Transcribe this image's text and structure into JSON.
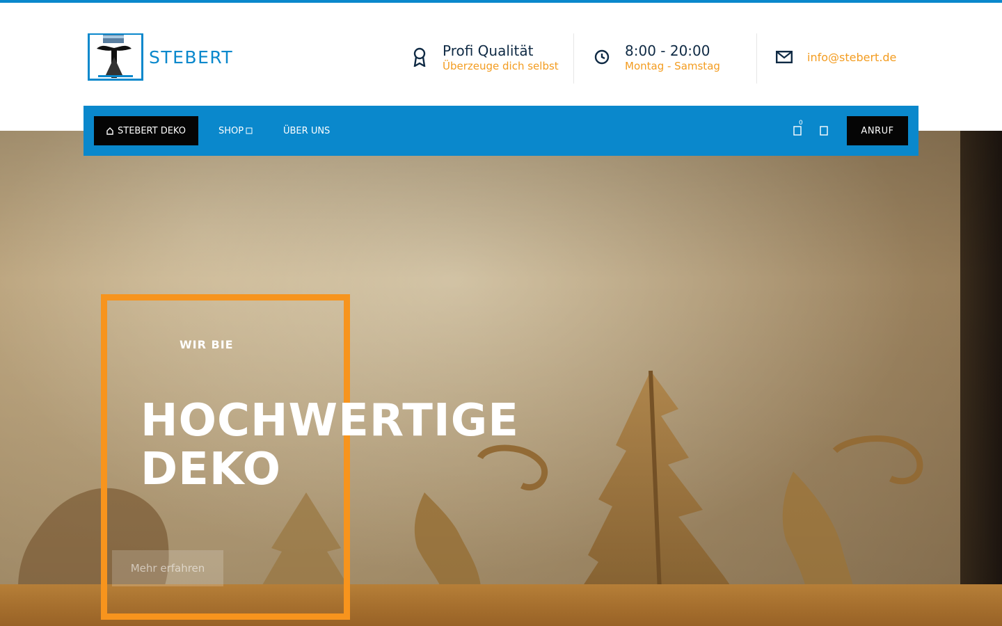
{
  "brand": {
    "name": "STEBERT",
    "accent": "#0a88cc",
    "highlight": "#f39c20"
  },
  "header": {
    "quality": {
      "title": "Profi Qualität",
      "subtitle": "Überzeuge dich selbst",
      "icon": "award-icon"
    },
    "hours": {
      "title": "8:00 - 20:00",
      "subtitle": "Montag - Samstag",
      "icon": "clock-icon"
    },
    "contact": {
      "email": "info@stebert.de",
      "icon": "mail-icon"
    }
  },
  "nav": {
    "deko_label": "STEBERT DEKO",
    "shop_label": "SHOP",
    "about_label": "ÜBER UNS",
    "cart_count": "0",
    "call_label": "ANRUF"
  },
  "hero": {
    "kicker": "WIR BIE",
    "headline_line1": "HOCHWERTIGE",
    "headline_line2": "DEKO",
    "cta_label": "Mehr erfahren",
    "frame_color": "#f7941d"
  }
}
